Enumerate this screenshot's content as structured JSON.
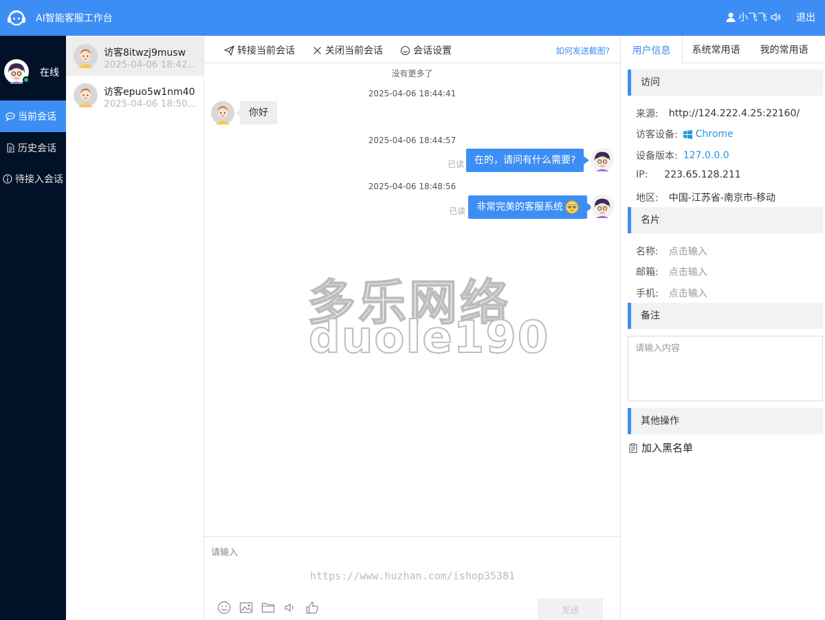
{
  "header": {
    "title": "AI智能客服工作台",
    "username": "小飞飞",
    "logout": "退出"
  },
  "leftnav": {
    "status": "在线",
    "items": [
      {
        "label": "当前会话"
      },
      {
        "label": "历史会话"
      },
      {
        "label": "待接入会话"
      }
    ]
  },
  "visitors": [
    {
      "name": "访客8itwzj9musw",
      "time": "2025-04-06 18:42..."
    },
    {
      "name": "访客epuo5w1nm40",
      "time": "2025-04-06 18:50..."
    }
  ],
  "toolbar": {
    "transfer": "转接当前会话",
    "close": "关闭当前会话",
    "settings": "会话设置",
    "help": "如何发送截图?"
  },
  "chat": {
    "no_more": "没有更多了",
    "messages": [
      {
        "time": "2025-04-06 18:44:41",
        "text": "你好"
      },
      {
        "time": "2025-04-06 18:44:57",
        "text": "在的，请问有什么需要?",
        "status": "已读"
      },
      {
        "time": "2025-04-06 18:48:56",
        "text": "非常完美的客服系统",
        "status": "已读"
      }
    ],
    "watermark_cn": "多乐网络",
    "watermark_en": "duole190",
    "url_watermark": "https://www.huzhan.com/ishop35381"
  },
  "input": {
    "placeholder": "请输入",
    "send": "发送"
  },
  "right": {
    "tabs": [
      "用户信息",
      "系统常用语",
      "我的常用语"
    ],
    "visit": {
      "title": "访问",
      "source_label": "来源:",
      "source": "http://124.222.4.25:22160/",
      "device_label": "访客设备:",
      "device": "Chrome",
      "version_label": "设备版本:",
      "version": "127.0.0.0",
      "ip_label": "IP:",
      "ip": "223.65.128.211",
      "region_label": "地区:",
      "region": "中国-江苏省-南京市-移动"
    },
    "card": {
      "title": "名片",
      "name_label": "名称:",
      "email_label": "邮箱:",
      "phone_label": "手机:",
      "click_input": "点击输入"
    },
    "note": {
      "title": "备注",
      "placeholder": "请输入内容"
    },
    "other": {
      "title": "其他操作",
      "blacklist": "加入黑名单"
    }
  },
  "colors": {
    "primary": "#3d8ef4",
    "nav_bg": "#011228",
    "online": "#1fc26b"
  }
}
